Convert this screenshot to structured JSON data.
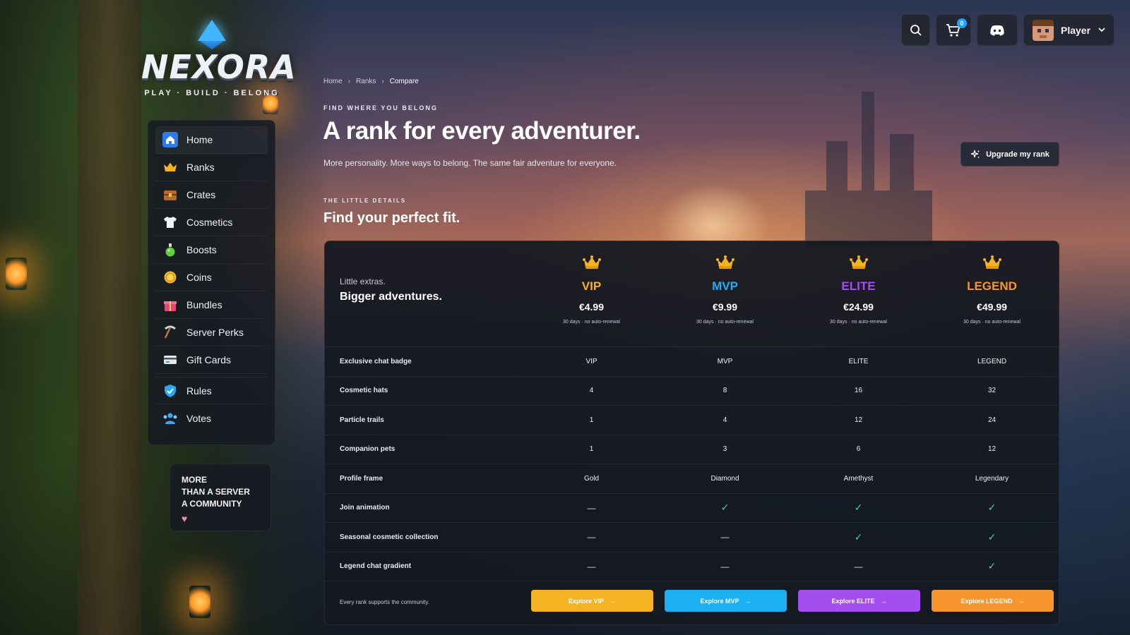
{
  "brand": {
    "logo_text": "NEXORA",
    "tagline": "PLAY · BUILD · BELONG",
    "gem_color": "#3fb6ff"
  },
  "topbar": {
    "cart_count": "0",
    "player_name": "Player",
    "icons": [
      "search-icon",
      "cart-icon",
      "discord-icon",
      "chevron-down-icon"
    ]
  },
  "sidebar": {
    "items": [
      {
        "label": "Home",
        "icon": "home-icon"
      },
      {
        "label": "Ranks",
        "icon": "crown-icon"
      },
      {
        "label": "Crates",
        "icon": "chest-icon"
      },
      {
        "label": "Cosmetics",
        "icon": "shirt-icon"
      },
      {
        "label": "Boosts",
        "icon": "potion-icon"
      },
      {
        "label": "Coins",
        "icon": "coin-icon"
      },
      {
        "label": "Bundles",
        "icon": "gift-icon"
      },
      {
        "label": "Server Perks",
        "icon": "pickaxe-icon"
      },
      {
        "label": "Gift Cards",
        "icon": "gift-card-icon"
      },
      {
        "label": "Rules",
        "icon": "shield-icon"
      },
      {
        "label": "Votes",
        "icon": "users-icon"
      }
    ]
  },
  "community": {
    "line1": "MORE",
    "line2": "THAN A SERVER",
    "line3": "A COMMUNITY"
  },
  "breadcrumb": [
    "Home",
    "Ranks",
    "Compare"
  ],
  "hero": {
    "eyebrow": "FIND WHERE YOU BELONG",
    "title": "A rank for every adventurer.",
    "subtitle": "More personality. More ways to belong. The same fair adventure for everyone.",
    "upgrade_label": "Upgrade my rank"
  },
  "compare": {
    "eyebrow": "THE LITTLE DETAILS",
    "title": "Find your perfect fit.",
    "intro_small": "Little extras.",
    "intro_big": "Bigger adventures.",
    "ranks": [
      {
        "name": "VIP",
        "price": "€4.99",
        "note": "30 days · no auto-renewal",
        "color": "#f5b324",
        "button": "Explore VIP"
      },
      {
        "name": "MVP",
        "price": "€9.99",
        "note": "30 days · no auto-renewal",
        "color": "#1ab0f2",
        "button": "Explore MVP"
      },
      {
        "name": "ELITE",
        "price": "€24.99",
        "note": "30 days · no auto-renewal",
        "color": "#a44ef0",
        "button": "Explore ELITE"
      },
      {
        "name": "LEGEND",
        "price": "€49.99",
        "note": "30 days · no auto-renewal",
        "color": "#f7962e",
        "button": "Explore LEGEND"
      }
    ],
    "features": [
      {
        "label": "Exclusive chat badge",
        "values": [
          "VIP",
          "MVP",
          "ELITE",
          "LEGEND"
        ]
      },
      {
        "label": "Cosmetic hats",
        "values": [
          "4",
          "8",
          "16",
          "32"
        ]
      },
      {
        "label": "Particle trails",
        "values": [
          "1",
          "4",
          "12",
          "24"
        ]
      },
      {
        "label": "Companion pets",
        "values": [
          "1",
          "3",
          "6",
          "12"
        ]
      },
      {
        "label": "Profile frame",
        "values": [
          "Gold",
          "Diamond",
          "Amethyst",
          "Legendary"
        ]
      },
      {
        "label": "Join animation",
        "values": [
          "—",
          "✓",
          "✓",
          "✓"
        ]
      },
      {
        "label": "Seasonal cosmetic collection",
        "values": [
          "—",
          "—",
          "✓",
          "✓"
        ]
      },
      {
        "label": "Legend chat gradient",
        "values": [
          "—",
          "—",
          "—",
          "✓"
        ]
      }
    ],
    "footer_note": "Every rank supports the community."
  }
}
